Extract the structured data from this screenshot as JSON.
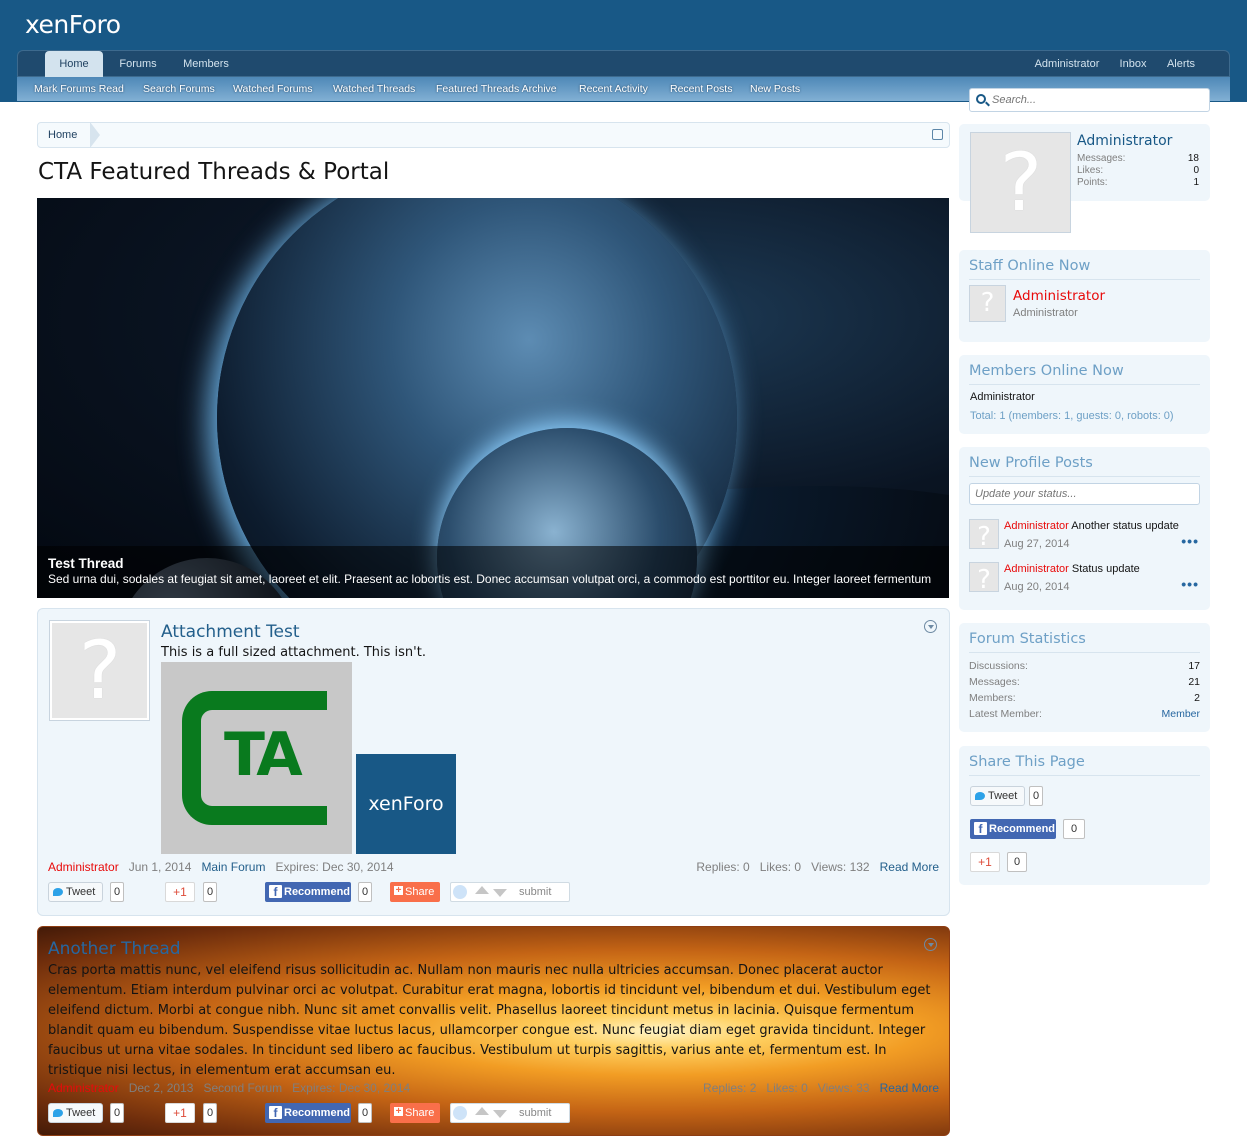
{
  "brand": {
    "logo": "xenForo"
  },
  "nav": {
    "tabs": [
      {
        "label": "Home"
      },
      {
        "label": "Forums"
      },
      {
        "label": "Members"
      }
    ],
    "right": [
      {
        "label": "Administrator"
      },
      {
        "label": "Inbox"
      },
      {
        "label": "Alerts"
      }
    ],
    "sub": [
      {
        "label": "Mark Forums Read"
      },
      {
        "label": "Search Forums"
      },
      {
        "label": "Watched Forums"
      },
      {
        "label": "Watched Threads"
      },
      {
        "label": "Featured Threads Archive"
      },
      {
        "label": "Recent Activity"
      },
      {
        "label": "Recent Posts"
      },
      {
        "label": "New Posts"
      }
    ]
  },
  "search": {
    "placeholder": "Search..."
  },
  "breadcrumb": {
    "home": "Home"
  },
  "page": {
    "title": "CTA Featured Threads & Portal"
  },
  "slider": {
    "title": "Test Thread",
    "body": "Sed urna dui, sodales at feugiat sit amet, laoreet et elit. Praesent ac lobortis est. Donec accumsan volutpat orci, a commodo est porttitor eu. Integer laoreet fermentum"
  },
  "threads": [
    {
      "title": "Attachment Test",
      "desc": "This is a full sized attachment. This isn't.",
      "attachment_text": "TA",
      "attachment2": "xenForo",
      "user": "Administrator",
      "date": "Jun 1, 2014",
      "forum": "Main Forum",
      "expires": "Expires: Dec 30, 2014",
      "replies": "Replies: 0",
      "likes": "Likes: 0",
      "views": "Views: 132",
      "readmore": "Read More"
    },
    {
      "title": "Another Thread",
      "body": "Cras porta mattis nunc, vel eleifend risus sollicitudin ac. Nullam non mauris nec nulla ultricies accumsan. Donec placerat auctor elementum. Etiam interdum pulvinar orci ac volutpat. Curabitur erat magna, lobortis id tincidunt vel, bibendum et dui. Vestibulum eget eleifend dictum. Morbi at congue nibh. Nunc sit amet convallis velit. Phasellus laoreet tincidunt metus in lacinia. Quisque fermentum blandit quam eu bibendum. Suspendisse vitae luctus lacus, ullamcorper congue est. Nunc feugiat diam eget gravida tincidunt. Integer faucibus ut urna vitae sodales. In tincidunt sed libero ac faucibus. Vestibulum ut turpis sagittis, varius ante et, fermentum est. In tristique nisi lectus, in elementum erat accumsan eu.",
      "user": "Administrator",
      "date": "Dec 2, 2013",
      "forum": "Second Forum",
      "expires": "Expires: Dec 30, 2014",
      "replies": "Replies: 2",
      "likes": "Likes: 0",
      "views": "Views: 33",
      "readmore": "Read More"
    }
  ],
  "social": {
    "tweet": "Tweet",
    "tweet_count": "0",
    "gplus": "+1",
    "gplus_count": "0",
    "recommend": "Recommend",
    "recommend_count": "0",
    "share": "Share",
    "submit": "submit"
  },
  "sidebar": {
    "visitor": {
      "name": "Administrator",
      "messages_label": "Messages:",
      "messages": "18",
      "likes_label": "Likes:",
      "likes": "0",
      "points_label": "Points:",
      "points": "1"
    },
    "staff": {
      "heading": "Staff Online Now",
      "name": "Administrator",
      "title": "Administrator"
    },
    "members": {
      "heading": "Members Online Now",
      "name": "Administrator",
      "total": "Total: 1 (members: 1, guests: 0, robots: 0)"
    },
    "profile_posts": {
      "heading": "New Profile Posts",
      "placeholder": "Update your status...",
      "posts": [
        {
          "user": "Administrator",
          "text": "Another status update",
          "date": "Aug 27, 2014"
        },
        {
          "user": "Administrator",
          "text": "Status update",
          "date": "Aug 20, 2014"
        }
      ]
    },
    "stats": {
      "heading": "Forum Statistics",
      "discussions_label": "Discussions:",
      "discussions": "17",
      "messages_label": "Messages:",
      "messages": "21",
      "members_label": "Members:",
      "members": "2",
      "latest_label": "Latest Member:",
      "latest": "Member"
    },
    "share": {
      "heading": "Share This Page"
    }
  },
  "colors": {
    "header": "#185886",
    "accent": "#2767a0",
    "username": "#e80a0a"
  }
}
